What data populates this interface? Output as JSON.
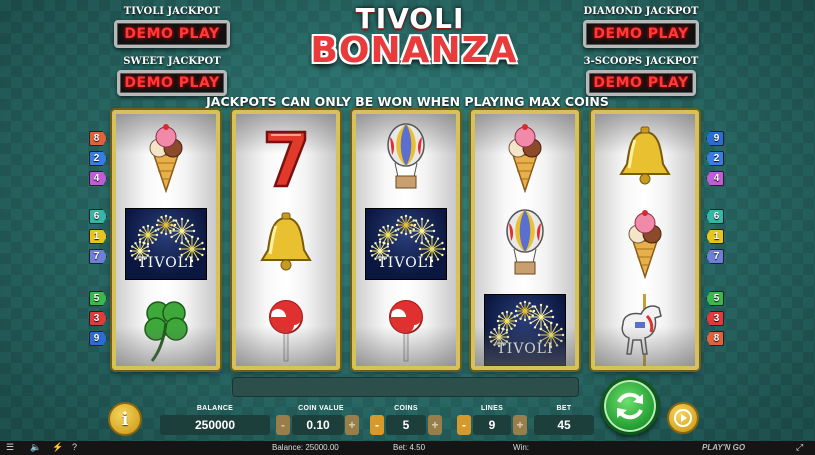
{
  "game": {
    "title_line1": "TIVOLI",
    "title_line2": "BONANZA",
    "banner": "JACKPOTS CAN ONLY BE WON WHEN PLAYING MAX COINS"
  },
  "jackpots": [
    {
      "name": "TIVOLI JACKPOT",
      "value": "DEMO PLAY"
    },
    {
      "name": "SWEET JACKPOT",
      "value": "DEMO PLAY"
    },
    {
      "name": "DIAMOND JACKPOT",
      "value": "DEMO PLAY"
    },
    {
      "name": "3-SCOOPS JACKPOT",
      "value": "DEMO PLAY"
    }
  ],
  "reels": [
    [
      "ice-cream",
      "tivoli",
      "clover"
    ],
    [
      "seven",
      "bell",
      "lollipop"
    ],
    [
      "balloon",
      "tivoli",
      "lollipop"
    ],
    [
      "ice-cream",
      "balloon",
      "tivoli"
    ],
    [
      "bell",
      "ice-cream",
      "carousel-horse"
    ]
  ],
  "symbol_text": {
    "tivoli": "TIVOLI"
  },
  "paylines_left": [
    {
      "n": "8",
      "color": "#e2603a"
    },
    {
      "n": "2",
      "color": "#3a7de0"
    },
    {
      "n": "4",
      "color": "#c25bd8"
    },
    {
      "n": "6",
      "color": "#33b8a8"
    },
    {
      "n": "1",
      "color": "#e8c420"
    },
    {
      "n": "7",
      "color": "#6f7fd8"
    },
    {
      "n": "5",
      "color": "#3ab84a"
    },
    {
      "n": "3",
      "color": "#e03a3a"
    },
    {
      "n": "9",
      "color": "#2a6cd8"
    }
  ],
  "paylines_right": [
    {
      "n": "9",
      "color": "#2a6cd8"
    },
    {
      "n": "2",
      "color": "#3a7de0"
    },
    {
      "n": "4",
      "color": "#c25bd8"
    },
    {
      "n": "6",
      "color": "#33b8a8"
    },
    {
      "n": "1",
      "color": "#e8c420"
    },
    {
      "n": "7",
      "color": "#6f7fd8"
    },
    {
      "n": "5",
      "color": "#3ab84a"
    },
    {
      "n": "3",
      "color": "#e03a3a"
    },
    {
      "n": "8",
      "color": "#e2603a"
    }
  ],
  "controls": {
    "info_label": "i",
    "balance_label": "BALANCE",
    "balance": "250000",
    "coin_value_label": "COIN VALUE",
    "coin_value": "0.10",
    "coins_label": "COINS",
    "coins": "5",
    "lines_label": "LINES",
    "lines": "9",
    "bet_label": "BET",
    "bet": "45",
    "minus": "-",
    "plus": "+"
  },
  "status": {
    "balance": "Balance: 25000.00",
    "bet": "Bet: 4.50",
    "win": "Win:",
    "brand": "PLAY'N GO"
  },
  "colors": {
    "jackpot_text": "#ff3a3a",
    "reel_frame": "#d6c15a",
    "spin": "#1e9a2e",
    "accent": "#d79a2a"
  }
}
